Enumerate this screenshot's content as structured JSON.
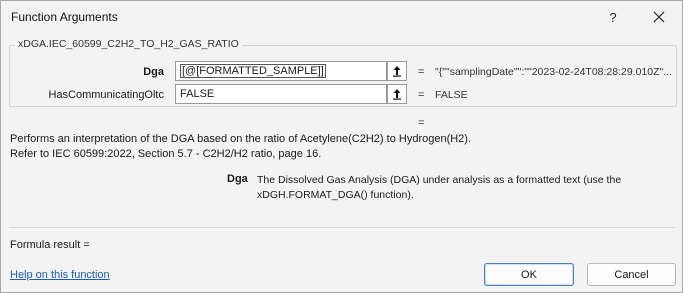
{
  "window": {
    "title": "Function Arguments",
    "help_glyph": "?"
  },
  "function": {
    "name": "xDGA.IEC_60599_C2H2_TO_H2_GAS_RATIO"
  },
  "arguments": [
    {
      "label": "Dga",
      "value": "[@[FORMATTED_SAMPLE]]",
      "equals": "=",
      "result": "\"{\"\"samplingDate\"\":\"\"2023-02-24T08:28:29.010Z\"..."
    },
    {
      "label": "HasCommunicatingOltc",
      "value": "FALSE",
      "equals": "=",
      "result": "FALSE"
    }
  ],
  "function_result_equals": "=",
  "description": {
    "line1": "Performs an interpretation of the DGA based on the ratio of Acetylene(C2H2) to Hydrogen(H2).",
    "line2": "Refer to IEC 60599:2022, Section 5.7 - C2H2/H2 ratio, page 16."
  },
  "parameter_help": {
    "name": "Dga",
    "text": "The Dissolved Gas Analysis (DGA) under analysis as a formatted text (use the xDGH.FORMAT_DGA() function)."
  },
  "formula_result": {
    "label": "Formula result ="
  },
  "links": {
    "help": "Help on this function"
  },
  "buttons": {
    "ok": "OK",
    "cancel": "Cancel"
  }
}
